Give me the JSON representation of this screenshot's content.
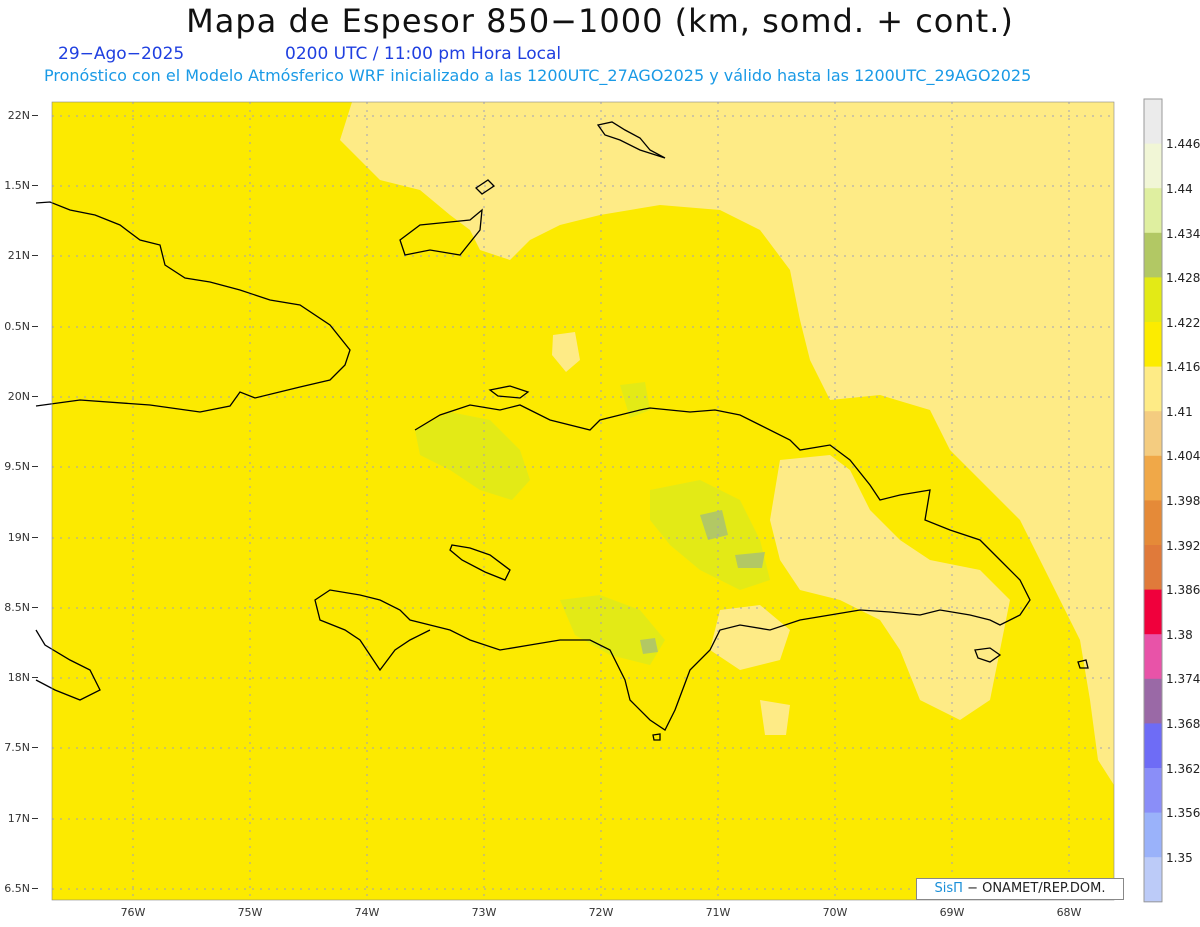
{
  "header": {
    "title": "Mapa de Espesor 850−1000 (km, somd. + cont.)",
    "date": "29−Ago−2025",
    "time": "0200 UTC / 11:00 pm Hora Local",
    "info": "Pronóstico con el Modelo Atmósferico WRF inicializado a las 1200UTC_27AGO2025 y válido hasta las  1200UTC_29AGO2025"
  },
  "axes": {
    "lat_labels": [
      "22N",
      "1.5N",
      "21N",
      "0.5N",
      "20N",
      "9.5N",
      "19N",
      "8.5N",
      "18N",
      "7.5N",
      "17N",
      "6.5N"
    ],
    "lon_labels": [
      "76W",
      "75W",
      "74W",
      "73W",
      "72W",
      "71W",
      "70W",
      "69W",
      "68W"
    ]
  },
  "colorbar": {
    "labels": [
      "1.446",
      "1.44",
      "1.434",
      "1.428",
      "1.422",
      "1.416",
      "1.41",
      "1.404",
      "1.398",
      "1.392",
      "1.386",
      "1.38",
      "1.374",
      "1.368",
      "1.362",
      "1.356",
      "1.35"
    ],
    "colors": [
      "#ebebeb",
      "#f1f6d6",
      "#dfefa0",
      "#b2c864",
      "#e3ea16",
      "#fcec00",
      "#feeb86",
      "#f4cc80",
      "#f0a848",
      "#e58a38",
      "#e07a3a",
      "#f0003c",
      "#e853a8",
      "#9a69a6",
      "#6e6cf6",
      "#8a8ef8",
      "#9ab2fa",
      "#bccbf8"
    ]
  },
  "colors": {
    "base_field": "#fcea00",
    "pale_field": "#feeb86",
    "green_field": "#e3ea16",
    "dark_green": "#b2c864",
    "coast": "#000000",
    "grid": "#a0a0b8"
  },
  "credit": {
    "brand": "SisΠ",
    "text": "− ONAMET/REP.DOM."
  }
}
